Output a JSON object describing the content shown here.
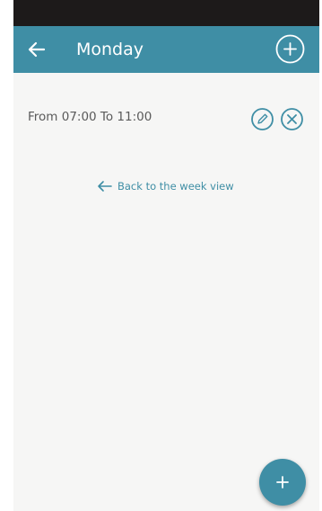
{
  "app_bar": {
    "title": "Monday",
    "back_icon": "arrow-left-icon",
    "add_icon": "plus-circle-icon"
  },
  "time_slots": [
    {
      "label": "From 07:00 To 11:00",
      "edit_icon": "pencil-circle-icon",
      "delete_icon": "x-circle-icon"
    }
  ],
  "back_link": {
    "label": "Back to the week view",
    "icon": "arrow-left-icon"
  },
  "fab": {
    "icon": "plus-icon"
  },
  "colors": {
    "primary": "#3f8ea5",
    "status_bar": "#1d1a1a",
    "background": "#f6f6f5",
    "text": "#5a5a5a"
  }
}
